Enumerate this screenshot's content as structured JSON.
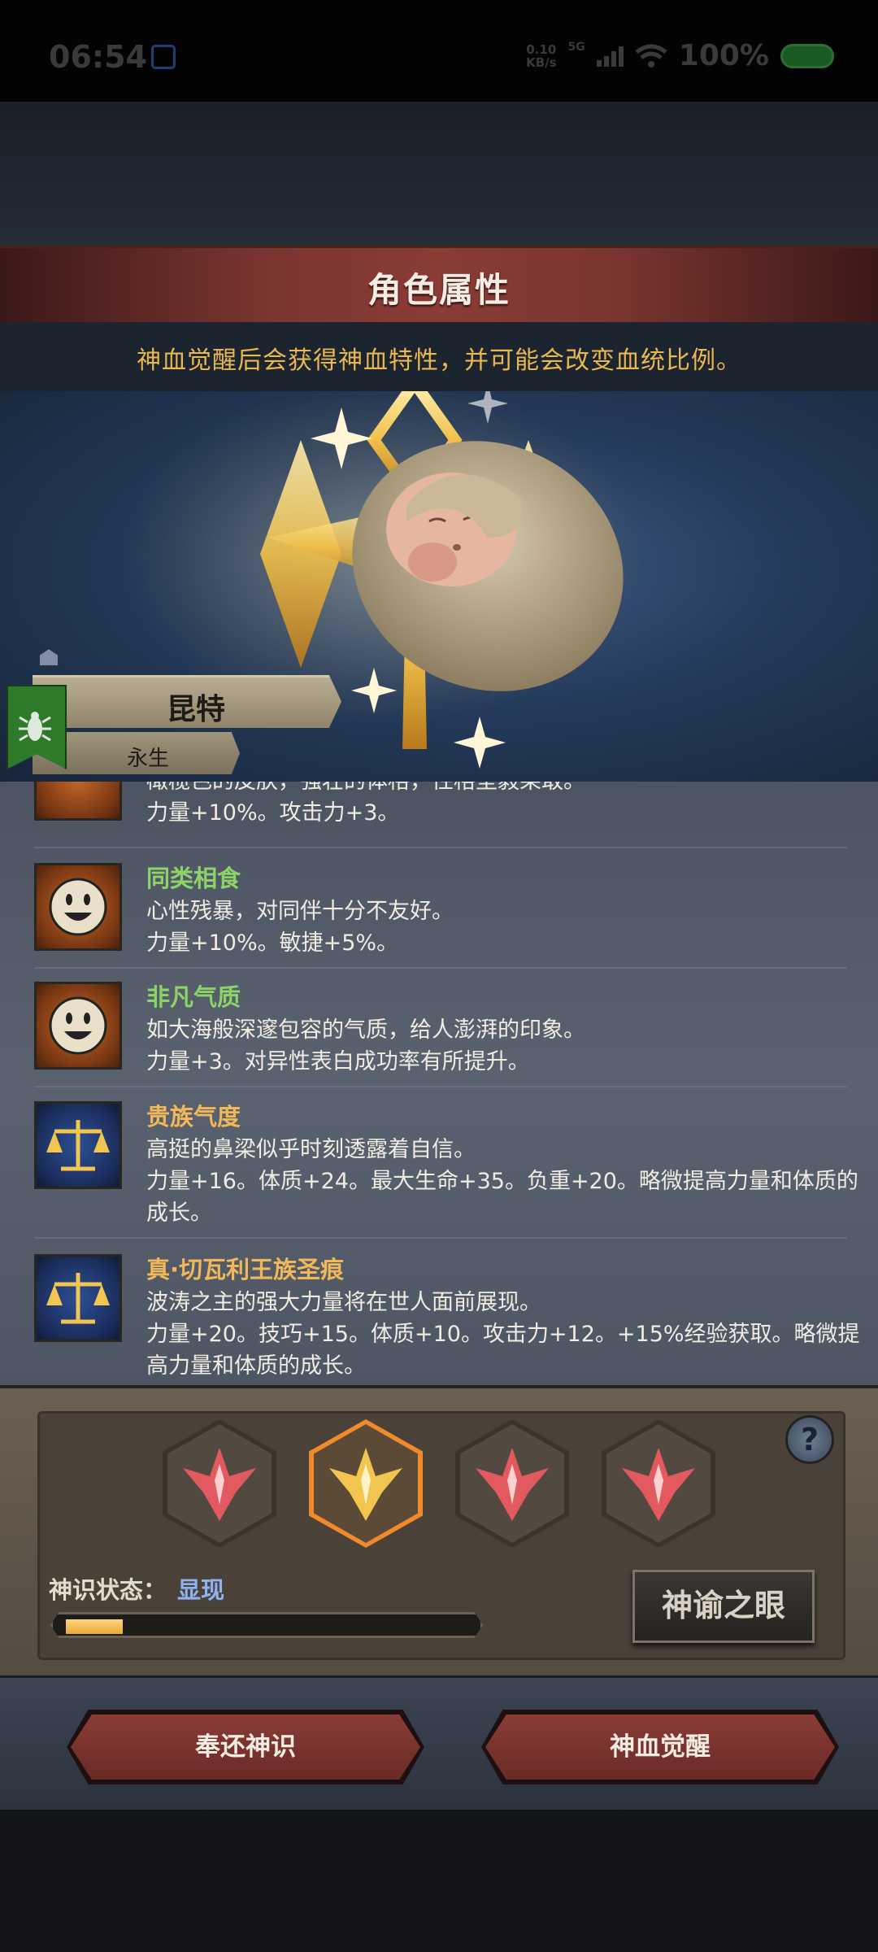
{
  "status_bar": {
    "time": "06:54",
    "net_speed": "0.10",
    "net_unit": "KB/s",
    "network": "5G",
    "battery": "100%"
  },
  "header": {
    "title": "角色属性"
  },
  "notice": "神血觉醒后会获得神血特性，并可能会改变血统比例。",
  "character": {
    "name": "昆特",
    "subtitle": "永生",
    "emblem_icon": "insect-icon"
  },
  "traits": [
    {
      "icon": "face-icon",
      "name": "",
      "lines": [
        "橄榄色的皮肤，强壮的体格，性格坚毅果敢。",
        "力量+10%。攻击力+3。"
      ]
    },
    {
      "icon": "face-icon",
      "name": "同类相食",
      "name_color": "#8ed36a",
      "lines": [
        "心性残暴，对同伴十分不友好。",
        "力量+10%。敏捷+5%。"
      ]
    },
    {
      "icon": "face-icon",
      "name": "非凡气质",
      "name_color": "#8ed36a",
      "lines": [
        "如大海般深邃包容的气质，给人澎湃的印象。",
        "力量+3。对异性表白成功率有所提升。"
      ]
    },
    {
      "icon": "scale-icon",
      "name": "贵族气度",
      "name_color": "#f0b858",
      "lines": [
        "高挺的鼻梁似乎时刻透露着自信。",
        "力量+16。体质+24。最大生命+35。负重+20。略微提高力量和体质的成长。"
      ]
    },
    {
      "icon": "scale-icon",
      "name": "真·切瓦利王族圣痕",
      "name_color": "#f0b858",
      "lines": [
        "波涛之主的强大力量将在世人面前展现。",
        "力量+20。技巧+15。体质+10。攻击力+12。+15%经验获取。略微提高力量和体质的成长。"
      ]
    }
  ],
  "divine_slots": [
    {
      "state": "red"
    },
    {
      "state": "gold-selected"
    },
    {
      "state": "red"
    },
    {
      "state": "red"
    }
  ],
  "divine_state": {
    "label": "神识状态：",
    "value": "显现",
    "progress": 0.14
  },
  "oracle_button": "神谕之眼",
  "help_icon": "?",
  "buttons": {
    "return": "奉还神识",
    "awaken": "神血觉醒"
  }
}
